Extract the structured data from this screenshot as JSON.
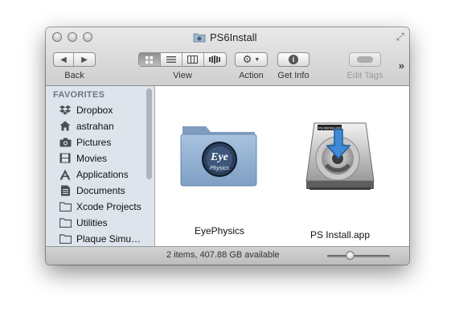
{
  "window": {
    "title": "PS6Install"
  },
  "toolbar": {
    "back_label": "Back",
    "view_label": "View",
    "action_label": "Action",
    "get_info_label": "Get Info",
    "edit_tags_label": "Edit Tags",
    "view_modes": [
      "icon-view",
      "list-view",
      "column-view",
      "coverflow-view"
    ],
    "selected_view": "icon-view"
  },
  "sidebar": {
    "heading": "FAVORITES",
    "items": [
      {
        "label": "Dropbox",
        "icon": "dropbox-icon"
      },
      {
        "label": "astrahan",
        "icon": "home-icon"
      },
      {
        "label": "Pictures",
        "icon": "camera-icon"
      },
      {
        "label": "Movies",
        "icon": "film-icon"
      },
      {
        "label": "Applications",
        "icon": "applications-icon"
      },
      {
        "label": "Documents",
        "icon": "document-icon"
      },
      {
        "label": "Xcode Projects",
        "icon": "folder-icon"
      },
      {
        "label": "Utilities",
        "icon": "folder-icon"
      },
      {
        "label": "Plaque Simu…",
        "icon": "folder-icon"
      }
    ]
  },
  "content": {
    "items": [
      {
        "label": "EyePhysics",
        "kind": "folder",
        "badge_text": "Eye",
        "badge_subtext": "Physics"
      },
      {
        "label": "PS Install.app",
        "kind": "installer-disk",
        "disk_label": "PS INSTALLER"
      }
    ]
  },
  "status": {
    "text": "2 items, 407.88 GB available",
    "icon_size_fraction": 0.36
  }
}
